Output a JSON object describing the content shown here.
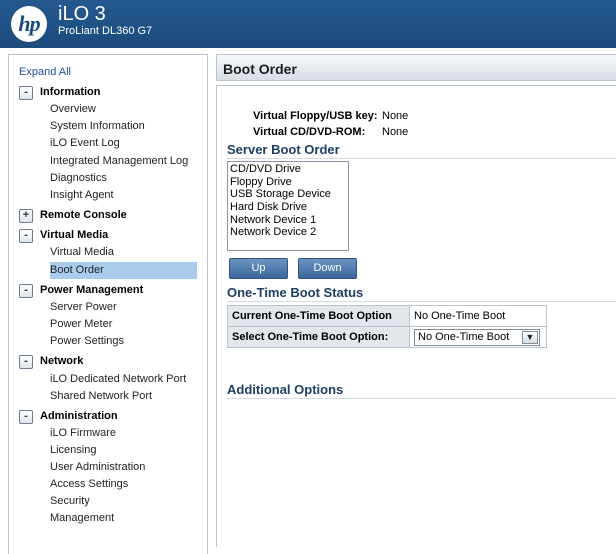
{
  "header": {
    "logo": "hp",
    "title": "iLO 3",
    "subtitle": "ProLiant DL360 G7",
    "colors": {
      "background": "#1d4b7c",
      "text": "#ffffff"
    }
  },
  "sidebar": {
    "expand_all": "Expand All",
    "sections": [
      {
        "toggle": "-",
        "label": "Information",
        "items": [
          "Overview",
          "System Information",
          "iLO Event Log",
          "Integrated Management Log",
          "Diagnostics",
          "Insight Agent"
        ]
      },
      {
        "toggle": "+",
        "label": "Remote Console",
        "items": []
      },
      {
        "toggle": "-",
        "label": "Virtual Media",
        "items": [
          "Virtual Media",
          "Boot Order"
        ]
      },
      {
        "toggle": "-",
        "label": "Power Management",
        "items": [
          "Server Power",
          "Power Meter",
          "Power Settings"
        ]
      },
      {
        "toggle": "-",
        "label": "Network",
        "items": [
          "iLO Dedicated Network Port",
          "Shared Network Port"
        ]
      },
      {
        "toggle": "-",
        "label": "Administration",
        "items": [
          "iLO Firmware",
          "Licensing",
          "User Administration",
          "Access Settings",
          "Security",
          "Management"
        ]
      }
    ],
    "selected_item": "Boot Order",
    "selected_color": "#a9cbec"
  },
  "main": {
    "page_title": "Boot Order",
    "virtual_floppy": {
      "label": "Virtual Floppy/USB key:",
      "value": "None"
    },
    "virtual_cd": {
      "label": "Virtual CD/DVD-ROM:",
      "value": "None"
    },
    "server_boot_order": {
      "title": "Server Boot Order",
      "items": [
        "CD/DVD Drive",
        "Floppy Drive",
        "USB Storage Device",
        "Hard Disk Drive",
        "Network Device 1",
        "Network Device 2"
      ],
      "up_button": "Up",
      "down_button": "Down"
    },
    "one_time_boot": {
      "title": "One-Time Boot Status",
      "current_label": "Current One-Time Boot Option",
      "current_value": "No One-Time Boot",
      "select_label": "Select One-Time Boot Option:",
      "select_value": "No One-Time Boot"
    },
    "additional_options": {
      "title": "Additional Options"
    },
    "heading_color": "#1f3e64"
  }
}
